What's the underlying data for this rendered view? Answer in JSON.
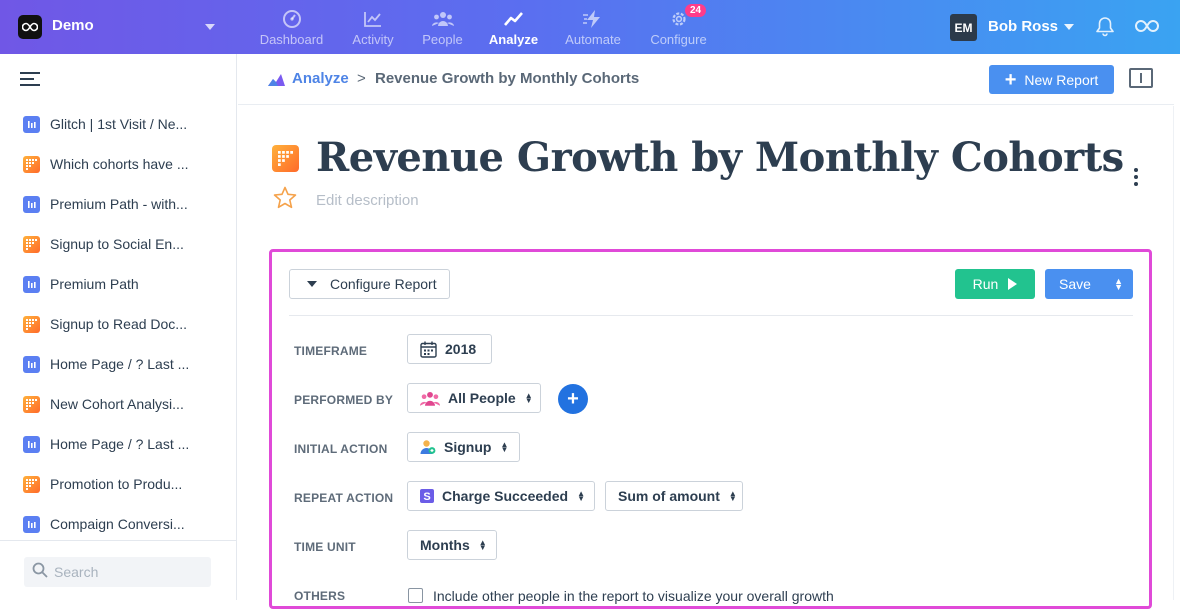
{
  "topbar": {
    "brand": "Demo",
    "nav": [
      {
        "label": "Dashboard",
        "icon": "dashboard-gauge-icon"
      },
      {
        "label": "Activity",
        "icon": "activity-chart-icon"
      },
      {
        "label": "People",
        "icon": "people-icon"
      },
      {
        "label": "Analyze",
        "icon": "analyze-trend-icon",
        "active": true
      },
      {
        "label": "Automate",
        "icon": "automate-bolt-icon"
      },
      {
        "label": "Configure",
        "icon": "configure-gear-icon",
        "badge": "24"
      }
    ],
    "user": {
      "initials": "EM",
      "name": "Bob Ross"
    }
  },
  "sidebar": {
    "items": [
      {
        "label": "Glitch | 1st Visit / Ne...",
        "color": "blue"
      },
      {
        "label": "Which cohorts have ...",
        "color": "orange"
      },
      {
        "label": "Premium Path - with...",
        "color": "blue"
      },
      {
        "label": "Signup to Social En...",
        "color": "orange"
      },
      {
        "label": "Premium Path",
        "color": "blue"
      },
      {
        "label": "Signup to Read Doc...",
        "color": "orange"
      },
      {
        "label": "Home Page / ? Last ...",
        "color": "blue"
      },
      {
        "label": "New Cohort Analysi...",
        "color": "orange"
      },
      {
        "label": "Home Page / ? Last ...",
        "color": "blue"
      },
      {
        "label": "Promotion to Produ...",
        "color": "orange"
      },
      {
        "label": "Compaign Conversi...",
        "color": "blue"
      }
    ],
    "search_placeholder": "Search"
  },
  "breadcrumb": {
    "root": "Analyze",
    "separator": ">",
    "current": "Revenue Growth by Monthly Cohorts"
  },
  "new_report_label": "New Report",
  "report": {
    "title": "Revenue Growth by Monthly Cohorts",
    "description_placeholder": "Edit description"
  },
  "config": {
    "configure_label": "Configure Report",
    "run_label": "Run",
    "save_label": "Save",
    "rows": {
      "timeframe": {
        "label": "TIMEFRAME",
        "value": "2018"
      },
      "performed_by": {
        "label": "PERFORMED BY",
        "value": "All People"
      },
      "initial_action": {
        "label": "INITIAL ACTION",
        "value": "Signup"
      },
      "repeat_action": {
        "label": "REPEAT ACTION",
        "value": "Charge Succeeded",
        "aggregate": "Sum of amount"
      },
      "time_unit": {
        "label": "TIME UNIT",
        "value": "Months"
      },
      "others": {
        "label": "OTHERS",
        "checkbox_label": "Include other people in the report to visualize your overall growth"
      }
    }
  },
  "colors": {
    "accent_blue": "#4a90f0",
    "run_green": "#22c38f",
    "highlight_magenta": "#e04ad8",
    "badge_pink": "#ff3c8a"
  }
}
